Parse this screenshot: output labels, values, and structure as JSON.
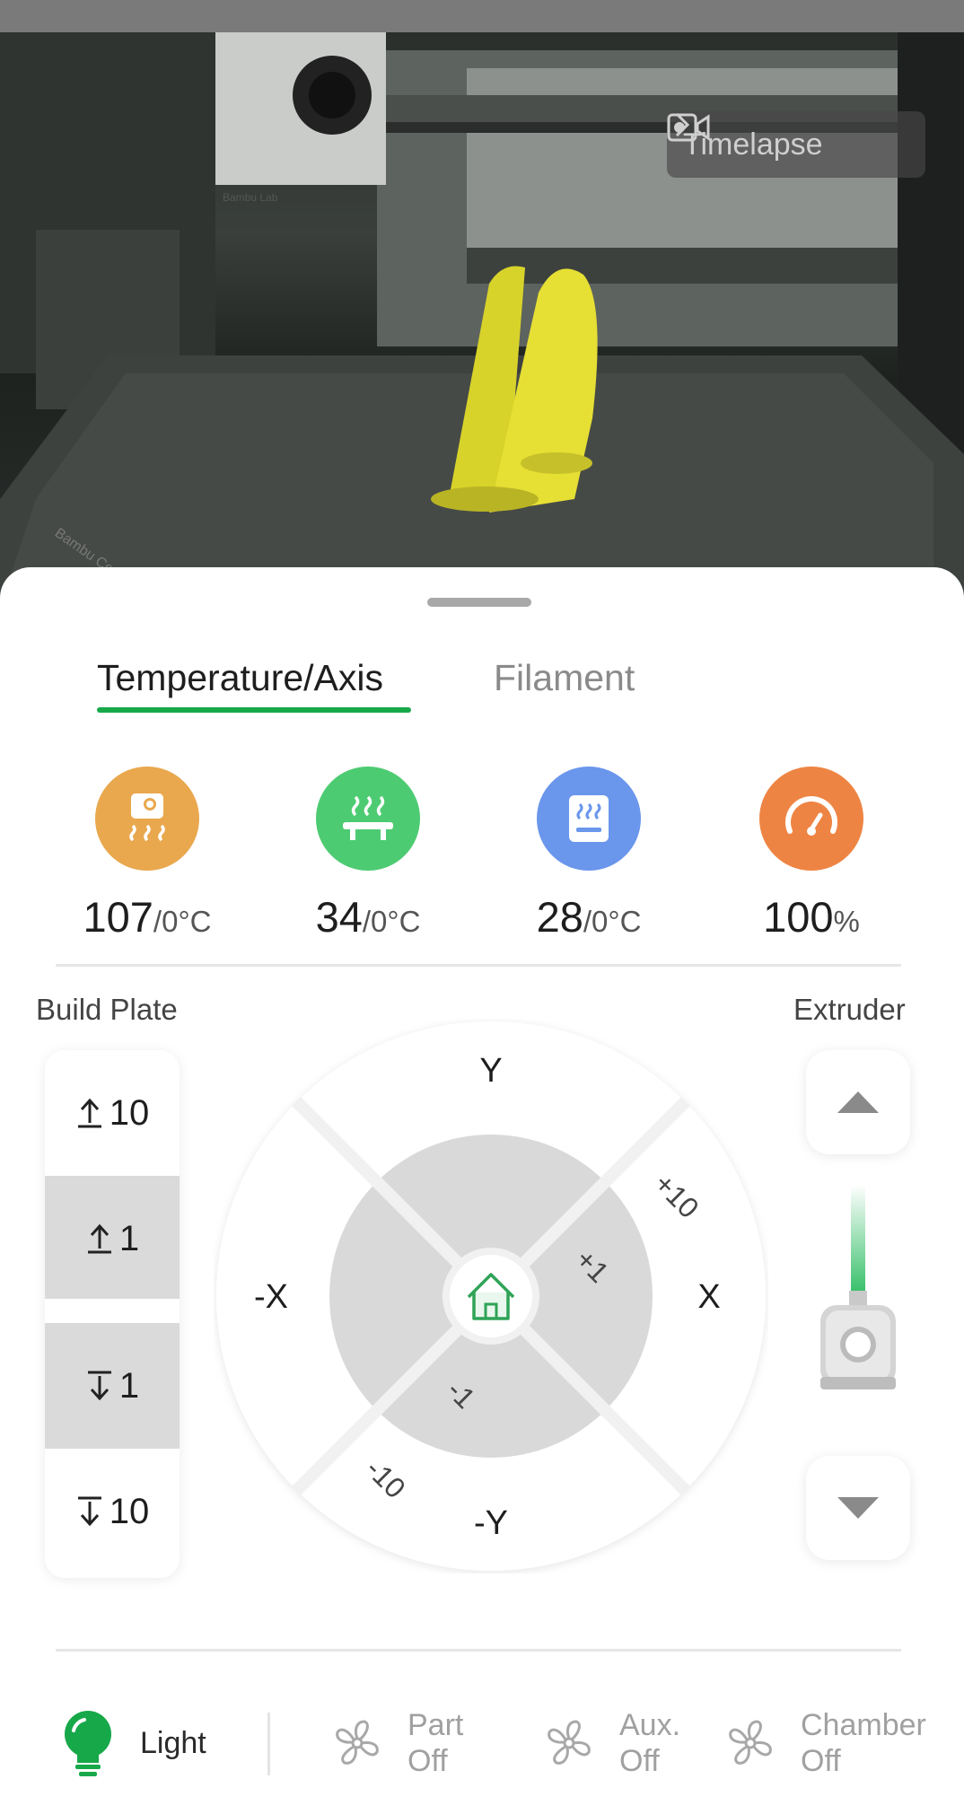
{
  "camera": {
    "timelapse_label": "Timelapse",
    "brand_text_1": "Bambu Lab",
    "brand_text_2": "Bambu Cool Pl"
  },
  "tabs": [
    {
      "label": "Temperature/Axis",
      "active": true
    },
    {
      "label": "Filament",
      "active": false
    }
  ],
  "temperatures": [
    {
      "icon": "nozzle-heat-icon",
      "color": "#E9A84E",
      "current": "107",
      "target": "/0°C"
    },
    {
      "icon": "heatbed-icon",
      "color": "#4DCB72",
      "current": "34",
      "target": "/0°C"
    },
    {
      "icon": "chamber-heat-icon",
      "color": "#6A96EC",
      "current": "28",
      "target": "/0°C"
    },
    {
      "icon": "speed-gauge-icon",
      "color": "#EE8443",
      "current": "100",
      "target": "%"
    }
  ],
  "build_plate": {
    "label": "Build Plate",
    "buttons": [
      "10",
      "1",
      "1",
      "10"
    ]
  },
  "axis_dial": {
    "y_plus": "Y",
    "y_minus": "-Y",
    "x_plus": "X",
    "x_minus": "-X",
    "plus_10": "+10",
    "plus_1": "+1",
    "minus_1": "-1",
    "minus_10": "-10"
  },
  "extruder": {
    "label": "Extruder"
  },
  "bottom_bar": {
    "light": {
      "label": "Light",
      "color": "#17A84A"
    },
    "part_fan": {
      "line1": "Part",
      "line2": "Off"
    },
    "aux_fan": {
      "line1": "Aux.",
      "line2": "Off"
    },
    "chamber_fan": {
      "line1": "Chamber",
      "line2": "Off"
    }
  },
  "colors": {
    "accent": "#17A84A"
  }
}
